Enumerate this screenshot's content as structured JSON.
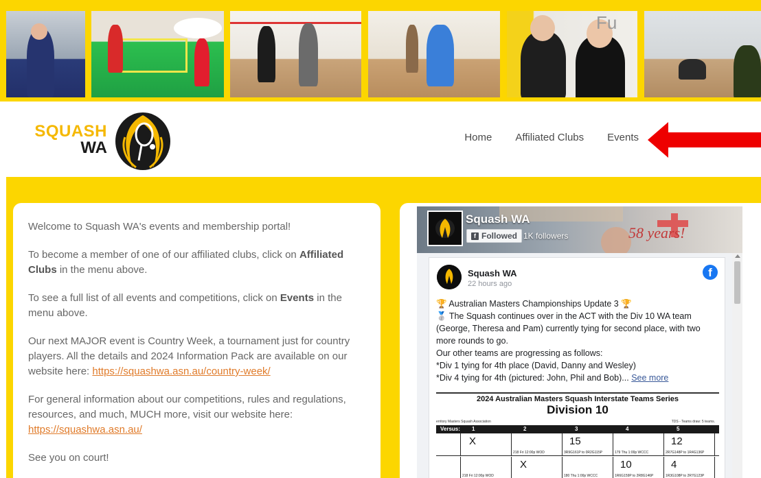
{
  "nav": {
    "home": "Home",
    "clubs": "Affiliated Clubs",
    "events": "Events"
  },
  "logo": {
    "line1": "SQUASH",
    "line2": "WA"
  },
  "welcome": {
    "p1": "Welcome to Squash WA's events and membership portal!",
    "p2_pre": "To become a member of one of our affiliated clubs, click on ",
    "p2_bold": "Affiliated Clubs",
    "p2_post": " in the menu above.",
    "p3_pre": "To see a full list of all events and competitions, click on ",
    "p3_bold": "Events",
    "p3_post": " in the menu above.",
    "p4_pre": "Our next MAJOR event is Country Week, a tournament just for country players.  All the details and 2024 Information Pack are available on our website here: ",
    "p4_link": "https://squashwa.asn.au/country-week/",
    "p5_pre": "For general information about our competitions, rules and regulations, resources, and much, MUCH more, visit our website here: ",
    "p5_link": "https://squashwa.asn.au/",
    "p6": "See you on court!"
  },
  "facebook": {
    "page_name": "Squash WA",
    "followed_label": "Followed",
    "follower_count": "1K followers",
    "cover_text": "58 years!",
    "post": {
      "author": "Squash WA",
      "time": "22 hours ago",
      "line1": "Australian Masters Championships Update 3",
      "line2": "The Squash continues over in the ACT with the Div 10 WA team (George, Theresa and Pam) currently tying for second place, with two more rounds to go.",
      "line3": "Our other teams are progressing as follows:",
      "line4": "*Div 1 tying for 4th place (David, Danny and Wesley)",
      "line5": "*Div 4 tying for 4th (pictured: John, Phil and Bob)...",
      "see_more": "See more"
    },
    "table": {
      "title": "2024 Australian Masters Squash Interstate Teams Series",
      "division": "Division 10",
      "meta_left": "erritory Masters Squash Association",
      "meta_right": "TDS - Teams draw: 5 teams.",
      "versus": "Versus:",
      "cols": [
        "1",
        "2",
        "3",
        "4",
        "5"
      ],
      "row1": {
        "c1": "X",
        "c2_small": "218 Fri 12:00p WOD",
        "c3": "15",
        "c3_small": "3R9G161P to 0R2G115P",
        "c4_small": "179 Thu 1:00p WCCC",
        "c5": "12",
        "c5_small": "2R7G148P to 1R4G136P"
      },
      "row2": {
        "c1_small": "218 Fri 12:00p WOD",
        "c2": "X",
        "c3_small": "180 Thu 1:00p WCCC",
        "c4": "10",
        "c4_small": "1R6G159P to 2R8G146P",
        "c5": "4",
        "c5_small": "1R3G108P to 2R7G123P"
      }
    }
  }
}
